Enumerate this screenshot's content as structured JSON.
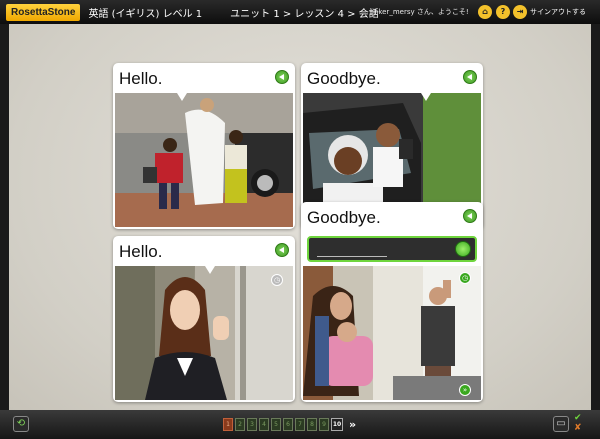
{
  "topbar": {
    "logo": "RosettaStone",
    "course": "英語 (イギリス) レベル 1",
    "breadcrumb": "ユニット 1 > レッスン 4 > 会話",
    "user_greeting": "linker_mersy さん、ようこそ!",
    "home_icon": "home-icon",
    "help_label": "?",
    "signout_label": "サインアウトする"
  },
  "cards": [
    {
      "caption": "Hello.",
      "audio_icon": "speaker-icon",
      "photo": "man-and-children-walking"
    },
    {
      "caption": "Goodbye.",
      "audio_icon": "speaker-icon",
      "photo": "people-in-car-waving"
    },
    {
      "caption": "Hello.",
      "audio_icon": "speaker-icon",
      "photo": "woman-waving-in-office"
    },
    {
      "caption": "Goodbye.",
      "audio_icon": "speaker-icon",
      "photo": "family-waving-at-door",
      "answer_value": ""
    }
  ],
  "bottombar": {
    "pages": [
      "1",
      "2",
      "3",
      "4",
      "5",
      "6",
      "7",
      "8",
      "9"
    ],
    "last_page": "10",
    "next_label": "»"
  },
  "colors": {
    "accent_green": "#6fd53d",
    "logo_yellow": "#f3c12b",
    "current_page": "#8a3a1c"
  }
}
